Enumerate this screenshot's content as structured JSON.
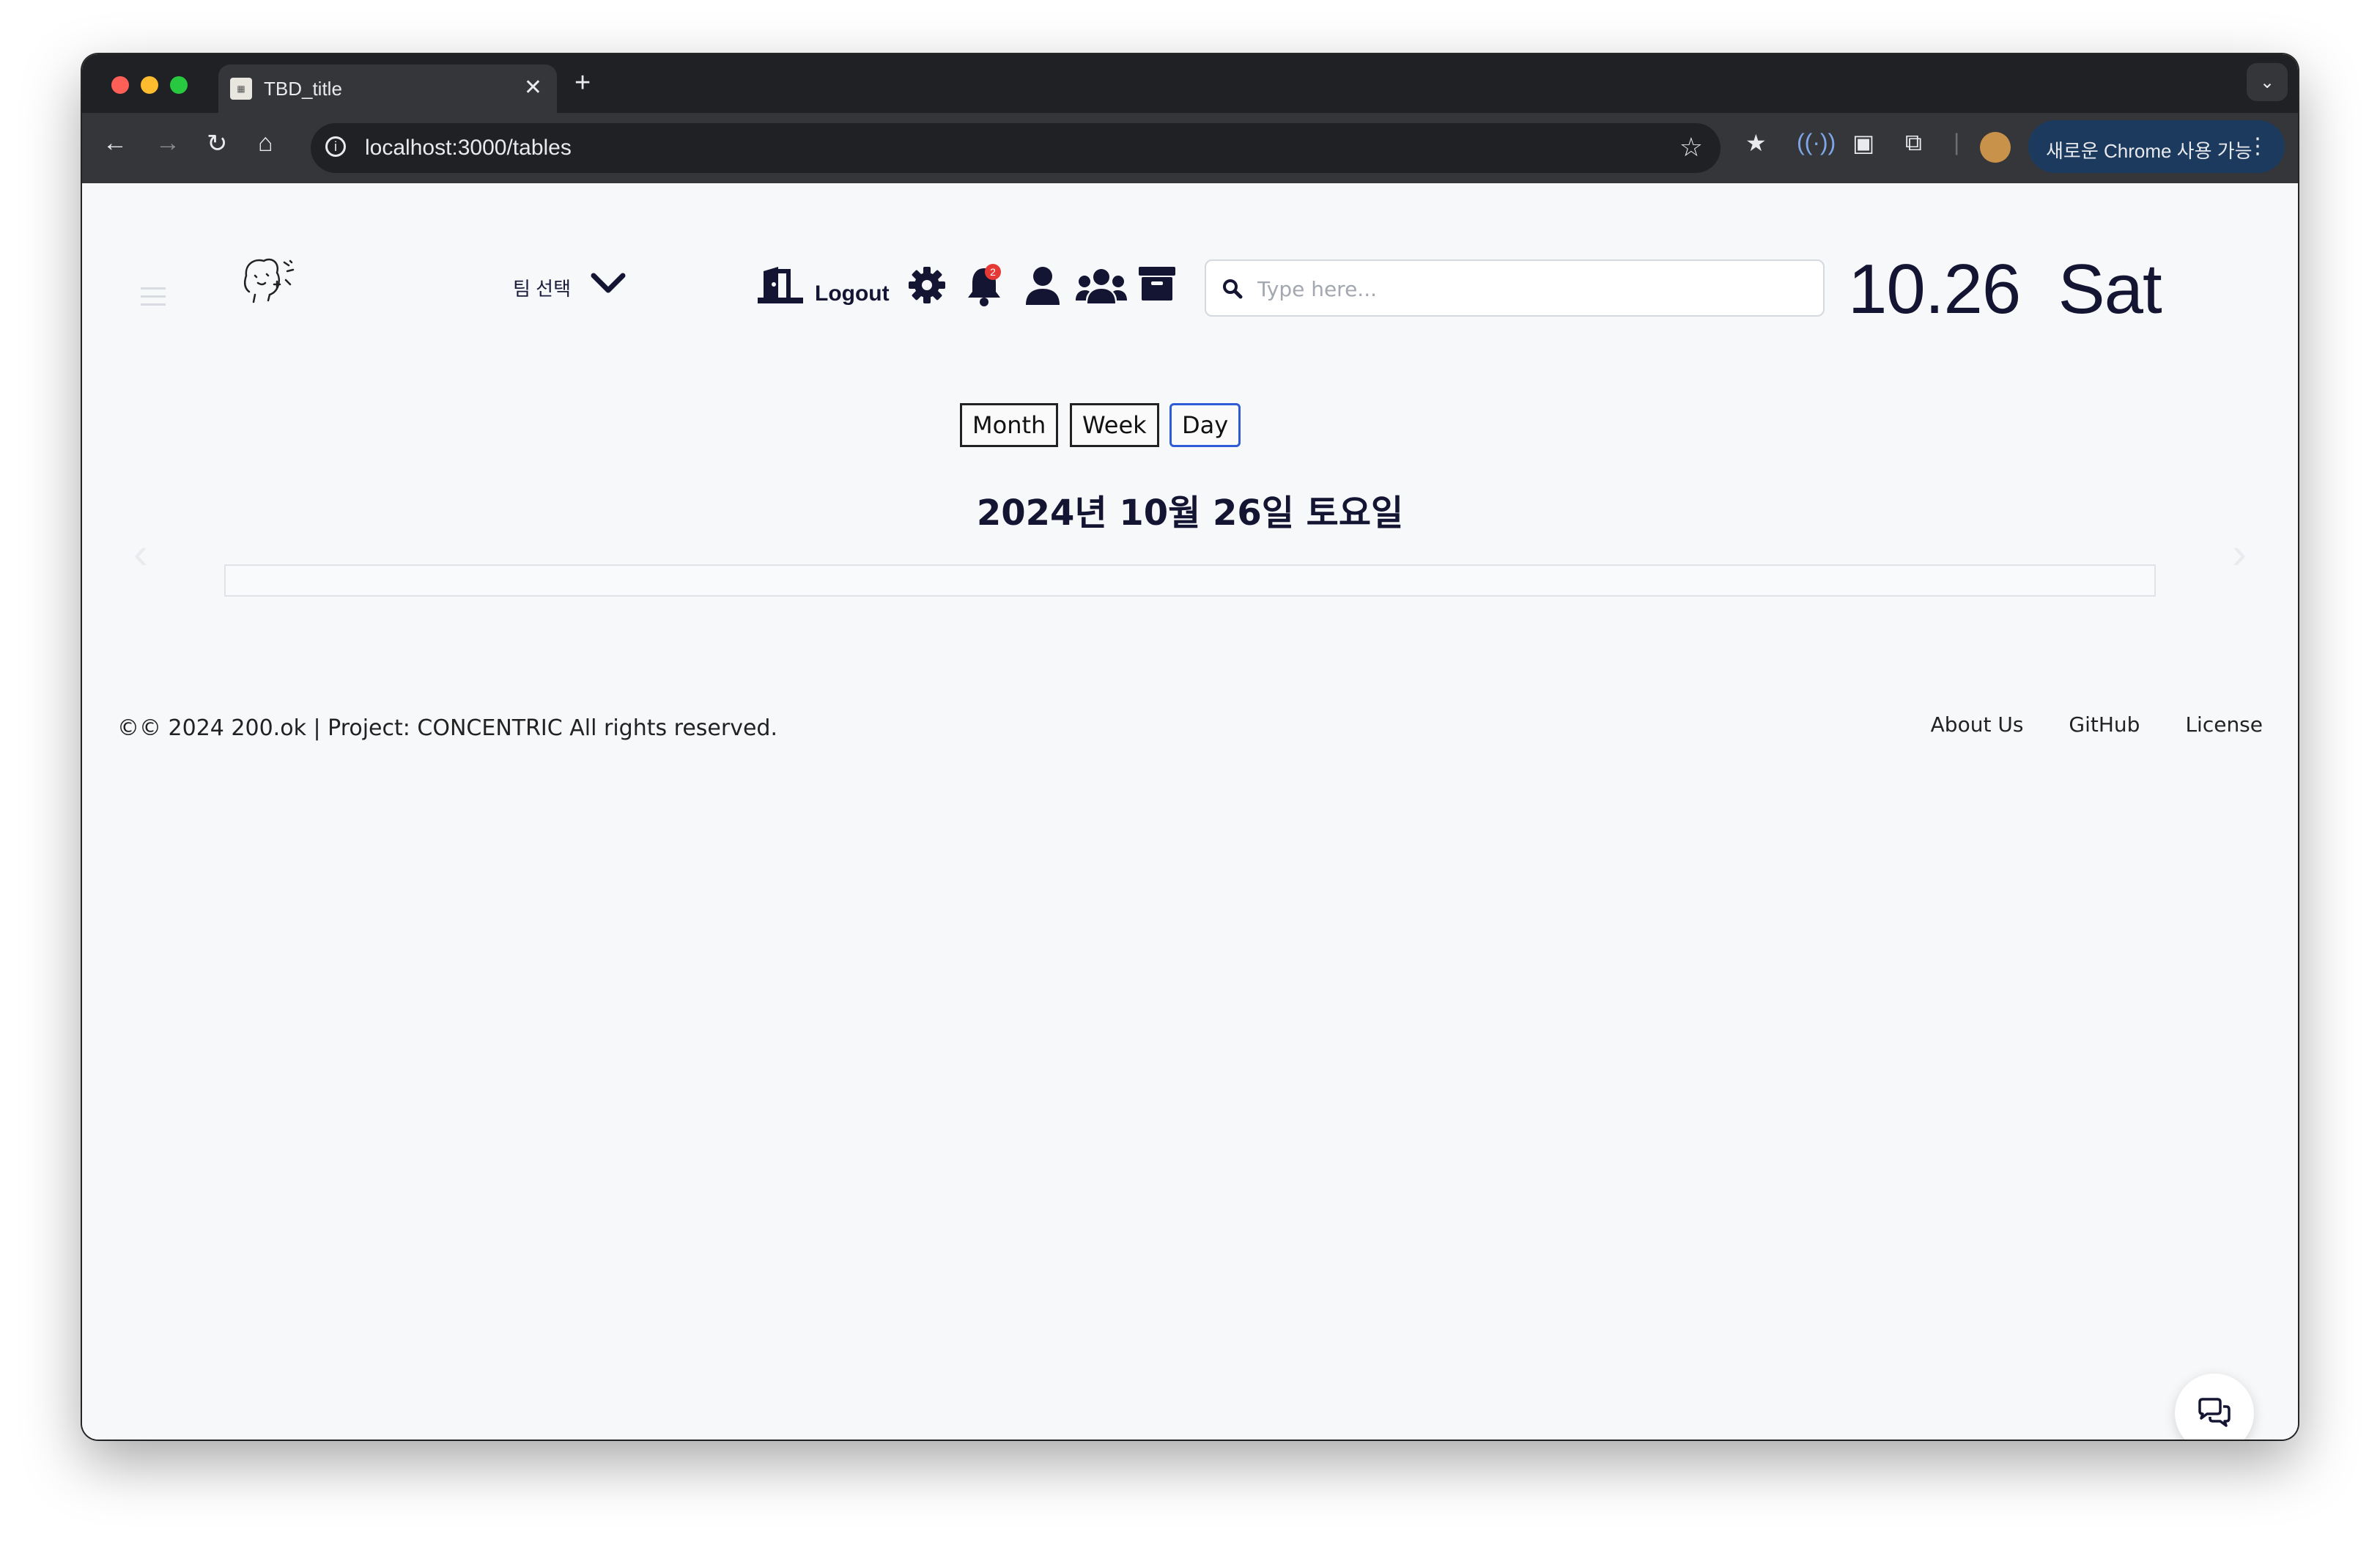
{
  "browser": {
    "tab_title": "TBD_title",
    "tab_close": "✕",
    "new_tab": "+",
    "url": "localhost:3000/tables",
    "update_label": "새로운 Chrome 사용 가능",
    "update_more": "⋮"
  },
  "header": {
    "team_select_label": "팀 선택",
    "logout_label": "Logout",
    "notification_count": "2",
    "search_placeholder": "Type here...",
    "date_display": "10.26  Sat"
  },
  "view_switcher": {
    "month_label": "Month",
    "week_label": "Week",
    "day_label": "Day",
    "active": "Day"
  },
  "day_view": {
    "title": "2024년 10월 26일 토요일"
  },
  "footer": {
    "copyright": "©© 2024 200.ok | Project: CONCENTRIC All rights reserved.",
    "links": [
      "About Us",
      "GitHub",
      "License"
    ]
  },
  "colors": {
    "primary_text": "#141433",
    "active_border": "#2e5bd6",
    "badge": "#e53935"
  }
}
